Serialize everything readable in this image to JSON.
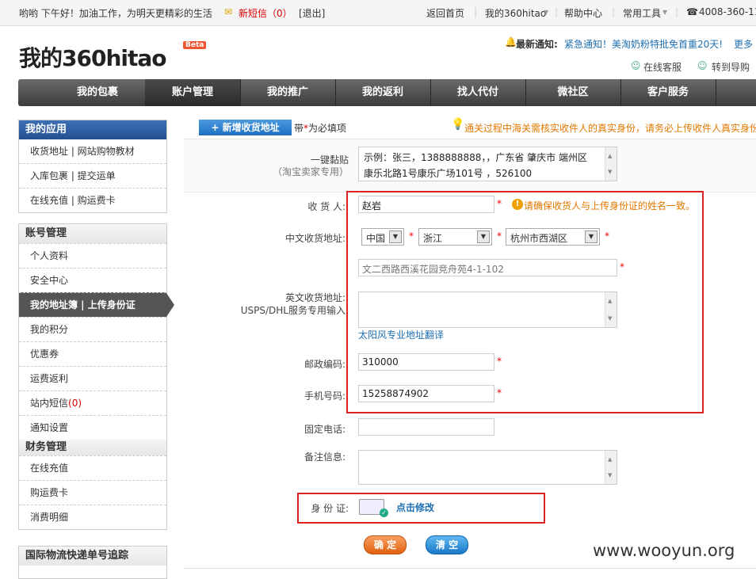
{
  "topbar": {
    "greeting": "哟哟  下午好！加油工作，为明天更精彩的生活",
    "new_message_label": "新短信（0）",
    "logout": "[退出]",
    "home": "返回首页",
    "my360": "我的360hitao",
    "help": "帮助中心",
    "tools": "常用工具",
    "phone": "4008-360-11"
  },
  "header": {
    "logo": "我的360hitao",
    "beta": "Beta",
    "notice_label": "最新通知:",
    "notice_text": "紧急通知！美淘奶粉特批免首重20天!",
    "more": "更多",
    "online_service": "在线客服",
    "guide": "转到导购"
  },
  "nav": [
    "我的包裹",
    "账户管理",
    "我的推广",
    "我的返利",
    "找人代付",
    "微社区",
    "客户服务"
  ],
  "sidebar": {
    "apps_title": "我的应用",
    "apps": [
      "收货地址 | 网站购物教材",
      "入库包裹 | 提交运单",
      "在线充值 | 购运费卡"
    ],
    "account_title": "账号管理",
    "account_items": [
      "个人资料",
      "安全中心",
      "我的地址簿 | 上传身份证",
      "我的积分",
      "优惠券",
      "运费返利"
    ],
    "inbox_label": "站内短信",
    "inbox_count": "(0)",
    "notify": "通知设置",
    "finance_title": "财务管理",
    "finance_items": [
      "在线充值",
      "购运费卡",
      "消费明细"
    ],
    "tracking_title": "国际物流快递单号追踪"
  },
  "form": {
    "add_address_button": "+ 新增收货地址",
    "required_note_prefix": "带",
    "required_note_star": "*",
    "required_note_suffix": "为必填项",
    "customs_notice": "通关过程中海关需核实收件人的真实身份，请务必上传收件人真实身份",
    "paste_label": "一键黏贴",
    "paste_sublabel": "（淘宝卖家专用）",
    "paste_line1": "示例：张三，1388888888，，广东省 肇庆市 端州区",
    "paste_line2": "康乐北路1号康乐广场101号 ，526100",
    "receiver_label": "收 货 人:",
    "receiver_value": "赵岩",
    "receiver_warning": "请确保收货人与上传身份证的姓名一致。",
    "cn_address_label": "中文收货地址:",
    "country": "中国",
    "province": "浙江",
    "city": "杭州市西湖区",
    "street_value": "文二西路西溪花园竞舟苑4-1-102",
    "en_address_label": "英文收货地址:",
    "en_address_sublabel": "USPS/DHL服务专用输入",
    "translate_link": "太阳风专业地址翻译",
    "zip_label": "邮政编码:",
    "zip_value": "310000",
    "mobile_label": "手机号码:",
    "mobile_value": "15258874902",
    "phone_label": "固定电话:",
    "remark_label": "备注信息:",
    "id_label": "身 份 证:",
    "id_link": "点击修改",
    "confirm": "确 定",
    "clear": "清 空"
  },
  "watermark": "www.wooyun.org",
  "colors": {
    "nav": "#4a4a4a",
    "sidebar_head": "#2f5fa5",
    "highlight_box": "#dd2222",
    "link": "#1f6fb3",
    "notice": "#e07800"
  }
}
